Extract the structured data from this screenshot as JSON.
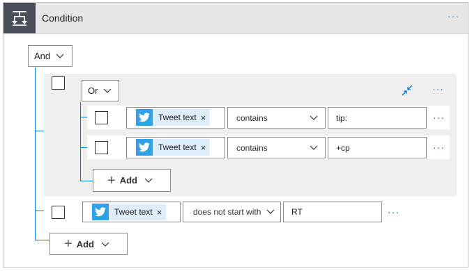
{
  "header": {
    "title": "Condition",
    "menu_icon": "more-icon",
    "icon": "condition-icon"
  },
  "root_group": {
    "operator": "And"
  },
  "or_group": {
    "operator": "Or",
    "collapse_icon": "collapse-icon",
    "rows": [
      {
        "token": "Tweet text",
        "operator": "contains",
        "value": "tip:"
      },
      {
        "token": "Tweet text",
        "operator": "contains",
        "value": "+cp"
      }
    ],
    "add_label": "Add"
  },
  "outer_row": {
    "token": "Tweet text",
    "operator": "does not start with",
    "value": "RT"
  },
  "add_label": "Add",
  "colors": {
    "accent": "#0078d4",
    "twitter": "#2fa1e8",
    "token_bg": "#ddeefa",
    "header_bg": "#e6e6e6"
  }
}
